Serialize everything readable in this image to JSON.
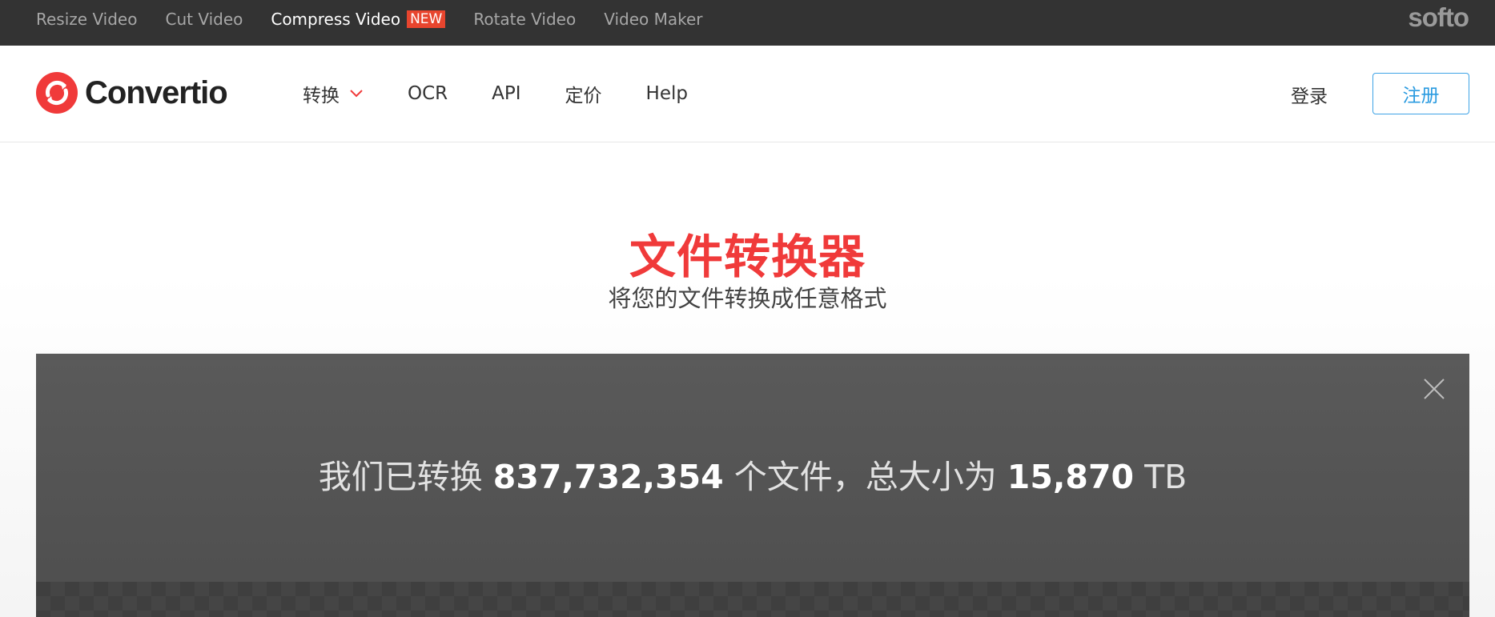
{
  "topbar": {
    "links": [
      {
        "label": "Resize Video",
        "active": false
      },
      {
        "label": "Cut Video",
        "active": false
      },
      {
        "label": "Compress Video",
        "active": true,
        "badge": "NEW"
      },
      {
        "label": "Rotate Video",
        "active": false
      },
      {
        "label": "Video Maker",
        "active": false
      }
    ],
    "brand": "softo"
  },
  "header": {
    "logo_text": "Convertio",
    "nav": {
      "convert": "转换",
      "ocr": "OCR",
      "api": "API",
      "pricing": "定价",
      "help": "Help"
    },
    "login": "登录",
    "signup": "注册"
  },
  "hero": {
    "title": "文件转换器",
    "subtitle": "将您的文件转换成任意格式"
  },
  "stats": {
    "prefix": "我们已转换",
    "files_count": "837,732,354",
    "middle": "个文件，总大小为",
    "total_size": "15,870",
    "unit": "TB"
  },
  "colors": {
    "brand_red": "#f03a3a",
    "signup_blue": "#2b9be0",
    "topbar_bg": "#333333",
    "panel_bg": "#555555",
    "badge_bg": "#e8452e"
  },
  "icons": {
    "logo": "convertio-logo-icon",
    "dropdown": "chevron-down-icon",
    "close": "close-icon"
  }
}
